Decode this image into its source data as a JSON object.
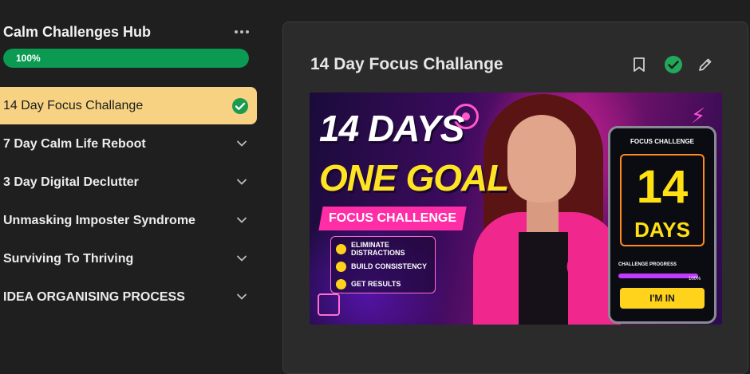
{
  "sidebar": {
    "title": "Calm Challenges Hub",
    "progress": {
      "label": "100%",
      "value": 1.0,
      "color": "#0a9a52"
    },
    "items": [
      {
        "label": "14 Day Focus Challange",
        "state": "completed",
        "icon": "check-circle-icon"
      },
      {
        "label": "7 Day Calm Life Reboot",
        "icon": "chevron-down-icon"
      },
      {
        "label": "3 Day Digital Declutter",
        "icon": "chevron-down-icon"
      },
      {
        "label": "Unmasking Imposter Syndrome",
        "icon": "chevron-down-icon"
      },
      {
        "label": "Surviving To Thriving",
        "icon": "chevron-down-icon"
      },
      {
        "label": "IDEA ORGANISING PROCESS",
        "icon": "chevron-down-icon"
      }
    ]
  },
  "lesson": {
    "title": "14 Day Focus Challange",
    "tools": [
      "bookmark-icon",
      "check-circle-icon",
      "pencil-icon"
    ],
    "thumbnail": {
      "line1": "14 DAYS",
      "line2": "ONE GOAL",
      "banner": "FOCUS CHALLENGE",
      "checklist": [
        "ELIMINATE DISTRACTIONS",
        "BUILD CONSISTENCY",
        "GET RESULTS"
      ],
      "tablet": {
        "header": "FOCUS CHALLENGE",
        "number": "14",
        "unit": "DAYS",
        "progress_label": "CHALLENGE PROGRESS",
        "progress_pct": "100%",
        "button": "I'M IN"
      }
    }
  },
  "colors": {
    "accent_active": "#f6d282",
    "success": "#0a9a52",
    "check": "#22c55e"
  }
}
